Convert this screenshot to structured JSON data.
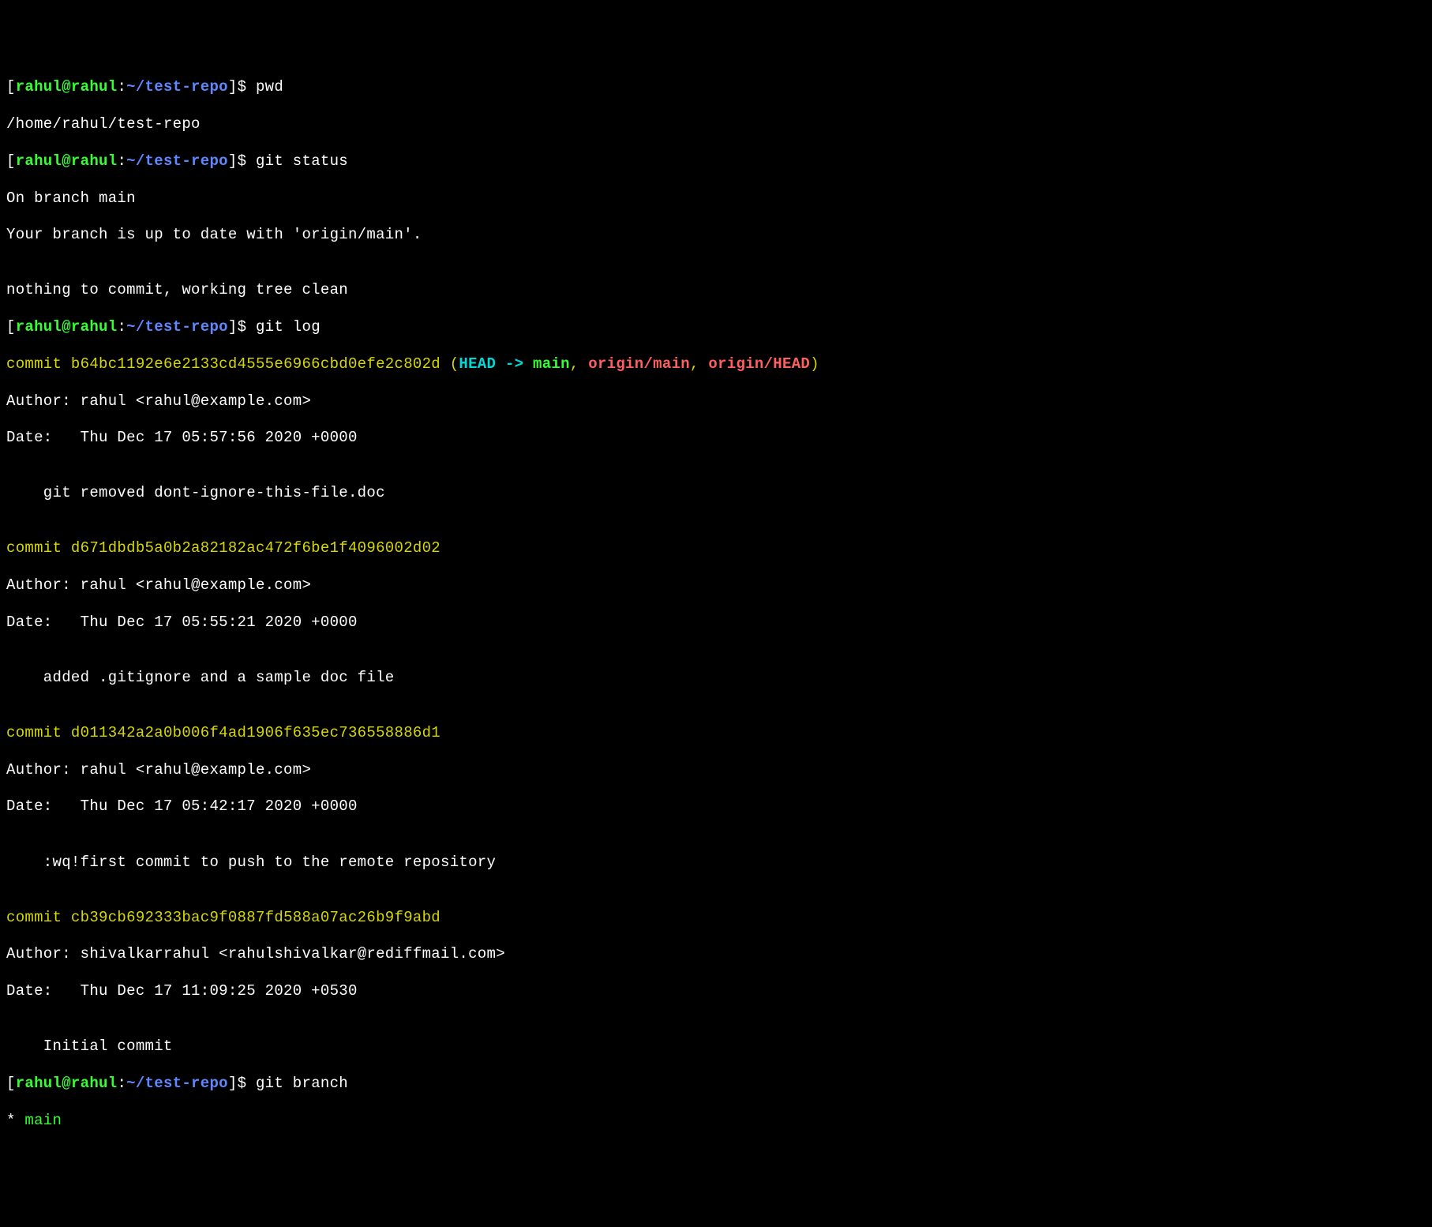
{
  "prompt": {
    "open_bracket": "[",
    "user": "rahul",
    "at": "@",
    "host": "rahul",
    "colon": ":",
    "tilde": "~",
    "path": "/test-repo",
    "close_bracket": "]",
    "dollar": "$"
  },
  "cmd_pwd": "pwd",
  "out_pwd": "/home/rahul/test-repo",
  "cmd_status": "git status",
  "out_status_line1": "On branch main",
  "out_status_line2": "Your branch is up to date with 'origin/main'.",
  "out_status_line3": "",
  "out_status_line4": "nothing to commit, working tree clean",
  "cmd_log": "git log",
  "commit1": {
    "label": "commit ",
    "hash": "b64bc1192e6e2133cd4555e6966cbd0efe2c802d",
    "paren_open": " (",
    "head": "HEAD -> ",
    "main": "main",
    "comma1": ", ",
    "origin_main": "origin/main",
    "comma2": ", ",
    "origin_head": "origin/HEAD",
    "paren_close": ")",
    "author": "Author: rahul <rahul@example.com>",
    "date": "Date:   Thu Dec 17 05:57:56 2020 +0000",
    "blank": "",
    "msg": "    git removed dont-ignore-this-file.doc",
    "blank2": ""
  },
  "commit2": {
    "label": "commit ",
    "hash": "d671dbdb5a0b2a82182ac472f6be1f4096002d02",
    "author": "Author: rahul <rahul@example.com>",
    "date": "Date:   Thu Dec 17 05:55:21 2020 +0000",
    "blank": "",
    "msg": "    added .gitignore and a sample doc file",
    "blank2": ""
  },
  "commit3": {
    "label": "commit ",
    "hash": "d011342a2a0b006f4ad1906f635ec736558886d1",
    "author": "Author: rahul <rahul@example.com>",
    "date": "Date:   Thu Dec 17 05:42:17 2020 +0000",
    "blank": "",
    "msg": "    :wq!first commit to push to the remote repository",
    "blank2": ""
  },
  "commit4": {
    "label": "commit ",
    "hash": "cb39cb692333bac9f0887fd588a07ac26b9f9abd",
    "author": "Author: shivalkarrahul <rahulshivalkar@rediffmail.com>",
    "date": "Date:   Thu Dec 17 11:09:25 2020 +0530",
    "blank": "",
    "msg": "    Initial commit"
  },
  "cmd_branch": "git branch",
  "out_branch_star": "* ",
  "out_branch_name": "main"
}
